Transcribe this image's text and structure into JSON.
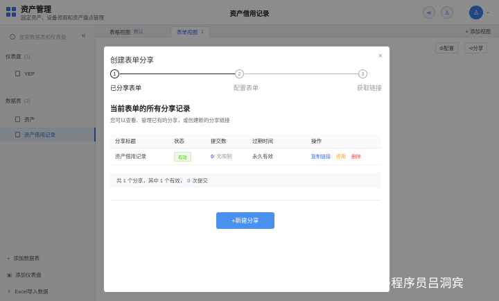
{
  "header": {
    "app_title": "资产管理",
    "app_subtitle": "固定资产、设备领用和资产盘点管理",
    "page_title": "资产借用记录",
    "share_icon": "share-icon",
    "user_icon": "user-icon",
    "avatar_icon": "person-icon"
  },
  "sidebar": {
    "search_placeholder": "搜索数据表和仪表盘",
    "collapse": "«",
    "dashboards_label": "仪表盘",
    "dashboards_count": "(1)",
    "dashboard_items": [
      {
        "label": "YEP"
      }
    ],
    "tables_label": "数据表",
    "tables_count": "(2)",
    "table_items": [
      {
        "label": "资产"
      },
      {
        "label": "资产借用记录"
      }
    ],
    "footer": [
      {
        "glyph": "+",
        "label": "添加数据表"
      },
      {
        "glyph": "▣",
        "label": "添加仪表盘"
      },
      {
        "glyph": "⇪",
        "label": "Excel导入数据"
      }
    ]
  },
  "main": {
    "tabs": [
      {
        "label": "表格视图",
        "badge": "默认"
      },
      {
        "label": "表单视图",
        "badge": "1"
      }
    ],
    "add_view": "+ 添加视图",
    "config_label": "⊚配置",
    "share_label": "⊲分享"
  },
  "modal": {
    "title": "创建表单分享",
    "close": "×",
    "steps": [
      {
        "num": "1",
        "label": "已分享表单",
        "done": true
      },
      {
        "num": "2",
        "label": "配置表单",
        "done": false
      },
      {
        "num": "3",
        "label": "获取链接",
        "done": false
      }
    ],
    "section_title": "当前表单的所有分享记录",
    "section_desc": "您可以查看、管理已有的分享，或创建新的分享链接",
    "table": {
      "columns": [
        "分享标题",
        "状态",
        "提交数",
        "过期时间",
        "操作"
      ],
      "rows": [
        {
          "title": "资产借用记录",
          "status": "有效",
          "submit_count": "0",
          "submit_limit": "/ 无限制",
          "expire": "永久有效",
          "actions": [
            "复制链接",
            "停用",
            "删除"
          ]
        }
      ]
    },
    "summary": {
      "prefix": "共 1 个分享，其中 1 个有效，",
      "count": "0",
      "suffix": "次提交"
    },
    "new_button": "+新建分享"
  },
  "watermark": "知乎 @程序员吕洞宾"
}
